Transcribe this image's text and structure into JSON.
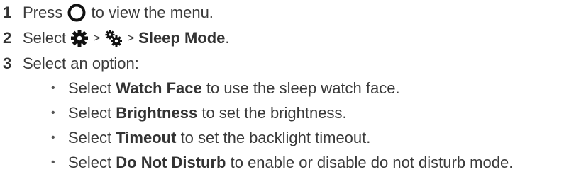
{
  "steps": [
    {
      "num": "1",
      "pre": "Press",
      "post": "to view the menu.",
      "icon": "circle-button-icon"
    },
    {
      "num": "2",
      "pre": "Select",
      "sep1": ">",
      "sep2": ">",
      "bold": "Sleep Mode",
      "post": ".",
      "icons": [
        "gear-icon",
        "gears-icon"
      ]
    },
    {
      "num": "3",
      "text": "Select an option:"
    }
  ],
  "options": [
    {
      "bullet": "•",
      "pre": "Select",
      "bold": "Watch Face",
      "post": "to use the sleep watch face."
    },
    {
      "bullet": "•",
      "pre": "Select",
      "bold": "Brightness",
      "post": "to set the brightness."
    },
    {
      "bullet": "•",
      "pre": "Select",
      "bold": "Timeout",
      "post": "to set the backlight timeout."
    },
    {
      "bullet": "•",
      "pre": "Select",
      "bold": "Do Not Disturb",
      "post": "to enable or disable do not disturb mode."
    }
  ]
}
